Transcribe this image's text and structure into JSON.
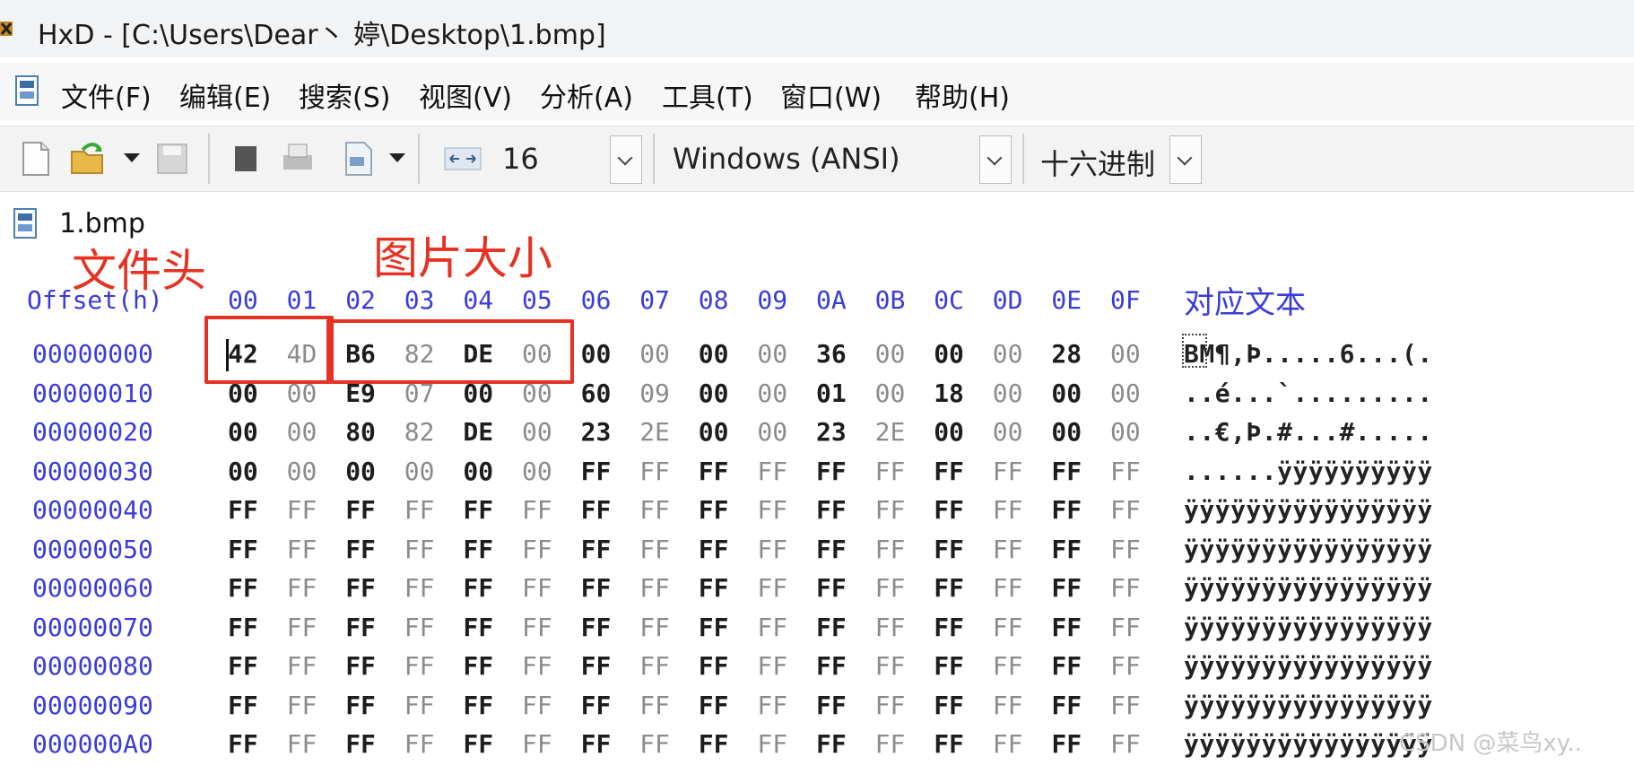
{
  "window": {
    "title": "HxD - [C:\\Users\\Dear丶 婷\\Desktop\\1.bmp]"
  },
  "menu": [
    "文件(F)",
    "编辑(E)",
    "搜索(S)",
    "视图(V)",
    "分析(A)",
    "工具(T)",
    "窗口(W)",
    "帮助(H)"
  ],
  "toolbar": {
    "bytes_per_row": "16",
    "charset": "Windows (ANSI)",
    "offset_base": "十六进制"
  },
  "tab": {
    "label": "1.bmp"
  },
  "annotations": {
    "file_header": "文件头",
    "image_size": "图片大小"
  },
  "hex_view": {
    "offset_header": "Offset(h)",
    "columns": [
      "00",
      "01",
      "02",
      "03",
      "04",
      "05",
      "06",
      "07",
      "08",
      "09",
      "0A",
      "0B",
      "0C",
      "0D",
      "0E",
      "0F"
    ],
    "text_header": "对应文本",
    "rows": [
      {
        "offset": "00000000",
        "bytes": [
          "42",
          "4D",
          "B6",
          "82",
          "DE",
          "00",
          "00",
          "00",
          "00",
          "00",
          "36",
          "00",
          "00",
          "00",
          "28",
          "00"
        ],
        "text": "BM¶‚Þ.....6...(."
      },
      {
        "offset": "00000010",
        "bytes": [
          "00",
          "00",
          "E9",
          "07",
          "00",
          "00",
          "60",
          "09",
          "00",
          "00",
          "01",
          "00",
          "18",
          "00",
          "00",
          "00"
        ],
        "text": "..é...`........."
      },
      {
        "offset": "00000020",
        "bytes": [
          "00",
          "00",
          "80",
          "82",
          "DE",
          "00",
          "23",
          "2E",
          "00",
          "00",
          "23",
          "2E",
          "00",
          "00",
          "00",
          "00"
        ],
        "text": "..€‚Þ.#...#....."
      },
      {
        "offset": "00000030",
        "bytes": [
          "00",
          "00",
          "00",
          "00",
          "00",
          "00",
          "FF",
          "FF",
          "FF",
          "FF",
          "FF",
          "FF",
          "FF",
          "FF",
          "FF",
          "FF"
        ],
        "text": "......ÿÿÿÿÿÿÿÿÿÿ"
      },
      {
        "offset": "00000040",
        "bytes": [
          "FF",
          "FF",
          "FF",
          "FF",
          "FF",
          "FF",
          "FF",
          "FF",
          "FF",
          "FF",
          "FF",
          "FF",
          "FF",
          "FF",
          "FF",
          "FF"
        ],
        "text": "ÿÿÿÿÿÿÿÿÿÿÿÿÿÿÿÿ"
      },
      {
        "offset": "00000050",
        "bytes": [
          "FF",
          "FF",
          "FF",
          "FF",
          "FF",
          "FF",
          "FF",
          "FF",
          "FF",
          "FF",
          "FF",
          "FF",
          "FF",
          "FF",
          "FF",
          "FF"
        ],
        "text": "ÿÿÿÿÿÿÿÿÿÿÿÿÿÿÿÿ"
      },
      {
        "offset": "00000060",
        "bytes": [
          "FF",
          "FF",
          "FF",
          "FF",
          "FF",
          "FF",
          "FF",
          "FF",
          "FF",
          "FF",
          "FF",
          "FF",
          "FF",
          "FF",
          "FF",
          "FF"
        ],
        "text": "ÿÿÿÿÿÿÿÿÿÿÿÿÿÿÿÿ"
      },
      {
        "offset": "00000070",
        "bytes": [
          "FF",
          "FF",
          "FF",
          "FF",
          "FF",
          "FF",
          "FF",
          "FF",
          "FF",
          "FF",
          "FF",
          "FF",
          "FF",
          "FF",
          "FF",
          "FF"
        ],
        "text": "ÿÿÿÿÿÿÿÿÿÿÿÿÿÿÿÿ"
      },
      {
        "offset": "00000080",
        "bytes": [
          "FF",
          "FF",
          "FF",
          "FF",
          "FF",
          "FF",
          "FF",
          "FF",
          "FF",
          "FF",
          "FF",
          "FF",
          "FF",
          "FF",
          "FF",
          "FF"
        ],
        "text": "ÿÿÿÿÿÿÿÿÿÿÿÿÿÿÿÿ"
      },
      {
        "offset": "00000090",
        "bytes": [
          "FF",
          "FF",
          "FF",
          "FF",
          "FF",
          "FF",
          "FF",
          "FF",
          "FF",
          "FF",
          "FF",
          "FF",
          "FF",
          "FF",
          "FF",
          "FF"
        ],
        "text": "ÿÿÿÿÿÿÿÿÿÿÿÿÿÿÿÿ"
      },
      {
        "offset": "000000A0",
        "bytes": [
          "FF",
          "FF",
          "FF",
          "FF",
          "FF",
          "FF",
          "FF",
          "FF",
          "FF",
          "FF",
          "FF",
          "FF",
          "FF",
          "FF",
          "FF",
          "FF"
        ],
        "text": "ÿÿÿÿÿÿÿÿÿÿÿÿÿÿÿÿ"
      }
    ]
  },
  "watermark": "CSDN @菜鸟xy.."
}
